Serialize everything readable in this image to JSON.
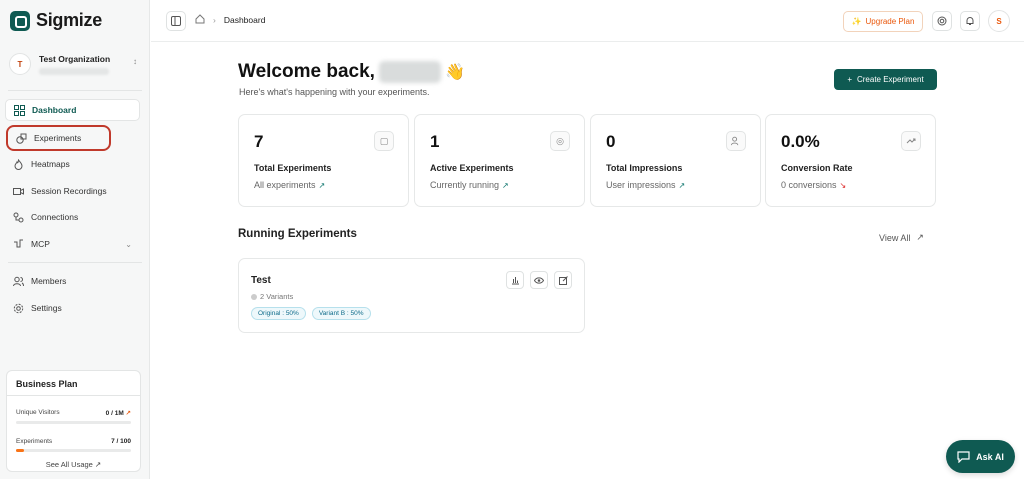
{
  "app": {
    "name": "Sigmize"
  },
  "org": {
    "avatar": "T",
    "name": "Test Organization"
  },
  "nav": {
    "items": [
      {
        "label": "Dashboard",
        "icon": "grid-icon"
      },
      {
        "label": "Experiments",
        "icon": "shapes-icon"
      },
      {
        "label": "Heatmaps",
        "icon": "flame-icon"
      },
      {
        "label": "Session Recordings",
        "icon": "video-icon"
      },
      {
        "label": "Connections",
        "icon": "connection-icon"
      },
      {
        "label": "MCP",
        "icon": "plug-icon"
      }
    ],
    "secondary": [
      {
        "label": "Members",
        "icon": "users-icon"
      },
      {
        "label": "Settings",
        "icon": "gear-icon"
      }
    ]
  },
  "plan": {
    "title": "Business Plan",
    "visitors_label": "Unique Visitors",
    "visitors_value": "0 / 1M",
    "visitors_fraction": 0,
    "experiments_label": "Experiments",
    "experiments_value": "7 / 100",
    "experiments_fraction": 0.07,
    "link": "See All Usage"
  },
  "topbar": {
    "breadcrumb_current": "Dashboard",
    "upgrade_label": "Upgrade Plan",
    "user_initial": "S"
  },
  "welcome": {
    "title": "Welcome back,",
    "emoji": "👋",
    "subtitle": "Here's what's happening with your experiments."
  },
  "create_button": "Create Experiment",
  "stats": [
    {
      "value": "7",
      "label": "Total Experiments",
      "sub": "All experiments",
      "trend": "up",
      "icon": "shapes-icon"
    },
    {
      "value": "1",
      "label": "Active Experiments",
      "sub": "Currently running",
      "trend": "up",
      "icon": "target-icon"
    },
    {
      "value": "0",
      "label": "Total Impressions",
      "sub": "User impressions",
      "trend": "up",
      "icon": "users-icon"
    },
    {
      "value": "0.0%",
      "label": "Conversion Rate",
      "sub": "0 conversions",
      "trend": "down",
      "icon": "trend-icon"
    }
  ],
  "running": {
    "title": "Running Experiments",
    "view_all": "View All",
    "experiments": [
      {
        "name": "Test",
        "variants": "2 Variants",
        "pills": [
          "Original : 50%",
          "Variant B : 50%"
        ]
      }
    ]
  },
  "ask_ai": "Ask AI",
  "colors": {
    "brand": "#0f5a52",
    "accent": "#ea580c",
    "highlight": "#c0392b"
  }
}
